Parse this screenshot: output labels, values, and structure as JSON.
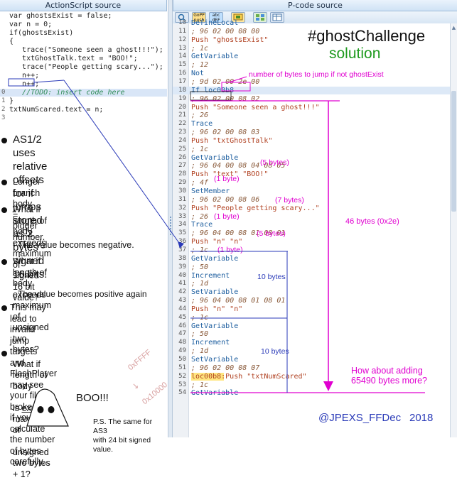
{
  "headers": {
    "left": "ActionScript source",
    "right": "P-code source"
  },
  "toolbar": {
    "buttons": [
      {
        "label": "",
        "icon": "search-icon"
      },
      {
        "label": "GoPP push"
      },
      {
        "label": "abc dEF"
      },
      {
        "label": "",
        "icon": "deobfuscate-icon"
      },
      {
        "label": "",
        "icon": "grid-icon"
      },
      {
        "label": "",
        "icon": "table-icon"
      }
    ]
  },
  "as_lines": [
    {
      "n": "",
      "t": "var ghostsExist = false;"
    },
    {
      "n": "",
      "t": "var n = 0;"
    },
    {
      "n": "",
      "t": "if(ghostsExist)"
    },
    {
      "n": "",
      "t": "{"
    },
    {
      "n": "",
      "t": "   trace(\"Someone seen a ghost!!!\");"
    },
    {
      "n": "",
      "t": "   txtGhostTalk.text = \"BOO!\";"
    },
    {
      "n": "",
      "t": "   trace(\"People getting scary...\");"
    },
    {
      "n": "",
      "t": "   n++;"
    },
    {
      "n": "",
      "t": "   n++;"
    },
    {
      "n": "0",
      "t": "   //TODO: insert code here"
    },
    {
      "n": "1",
      "t": "}"
    },
    {
      "n": "2",
      "t": "txtNumScared.text = n;"
    },
    {
      "n": "3",
      "t": ""
    }
  ],
  "info": {
    "b1": "AS1/2 uses relative offsets\nfor if jumps stored as 2\nbytes - signed 16 bits.",
    "b2": "Longer branch body\n= bigger number.",
    "b3": "What if length of body\nexceeds maximum of\nsigned 16 bit value?",
    "b3sub": "- The value becomes negative.",
    "b4": "What if length of body\nexceeds maximum of\nunsigned two bytes?",
    "b4sub": "- The value becomes positive again",
    "b5": "This may lead to invalid jump targets\nand FlashPlayer may see\nyour file broken, but if you calculate\nthe number of bytes carefully...",
    "b6a": "What if length of body",
    "b6b": "is ",
    "b6c": "exactly",
    "b6d": " maximum of",
    "b6e": "unsigned two bytes + 1?",
    "hex1": "0xFFFF",
    "hex2": "0x10000",
    "boo": "BOO!!!",
    "ps": "P.S. The same for AS3\nwith 24 bit signed value."
  },
  "pcode_lines": [
    {
      "n": "10",
      "t": "DefineLocal",
      "k": "i"
    },
    {
      "n": "11",
      "t": "; 96 02 00 08 00",
      "k": "c"
    },
    {
      "n": "12",
      "t": "Push \"ghostsExist\"",
      "k": "p"
    },
    {
      "n": "13",
      "t": "; 1c",
      "k": "c"
    },
    {
      "n": "14",
      "t": "GetVariable",
      "k": "i"
    },
    {
      "n": "15",
      "t": "; 12",
      "k": "c"
    },
    {
      "n": "16",
      "t": "Not",
      "k": "i"
    },
    {
      "n": "17",
      "t": "; 9d 02 00 2e 00",
      "k": "c"
    },
    {
      "n": "18",
      "t": "If loc00b8",
      "k": "if"
    },
    {
      "n": "19",
      "t": "; 96 02 00 08 02",
      "k": "c"
    },
    {
      "n": "20",
      "t": "Push \"Someone seen a ghost!!!\"",
      "k": "p"
    },
    {
      "n": "21",
      "t": "; 26",
      "k": "c"
    },
    {
      "n": "22",
      "t": "Trace",
      "k": "i"
    },
    {
      "n": "23",
      "t": "; 96 02 00 08 03",
      "k": "c"
    },
    {
      "n": "24",
      "t": "Push \"txtGhostTalk\"",
      "k": "p"
    },
    {
      "n": "25",
      "t": "; 1c",
      "k": "c"
    },
    {
      "n": "26",
      "t": "GetVariable",
      "k": "i"
    },
    {
      "n": "27",
      "t": "; 96 04 00 08 04 08 05",
      "k": "c"
    },
    {
      "n": "28",
      "t": "Push \"text\" \"BOO!\"",
      "k": "p"
    },
    {
      "n": "29",
      "t": "; 4f",
      "k": "c"
    },
    {
      "n": "30",
      "t": "SetMember",
      "k": "i"
    },
    {
      "n": "31",
      "t": "; 96 02 00 08 06",
      "k": "c"
    },
    {
      "n": "32",
      "t": "Push \"People getting scary...\"",
      "k": "p"
    },
    {
      "n": "33",
      "t": "; 26",
      "k": "c"
    },
    {
      "n": "34",
      "t": "Trace",
      "k": "i"
    },
    {
      "n": "35",
      "t": "; 96 04 00 08 01 08 01",
      "k": "c"
    },
    {
      "n": "36",
      "t": "Push \"n\" \"n\"",
      "k": "p"
    },
    {
      "n": "37",
      "t": "; 1c",
      "k": "c"
    },
    {
      "n": "38",
      "t": "GetVariable",
      "k": "i"
    },
    {
      "n": "39",
      "t": "; 50",
      "k": "c"
    },
    {
      "n": "40",
      "t": "Increment",
      "k": "i"
    },
    {
      "n": "41",
      "t": "; 1d",
      "k": "c"
    },
    {
      "n": "42",
      "t": "SetVariable",
      "k": "i"
    },
    {
      "n": "43",
      "t": "; 96 04 00 08 01 08 01",
      "k": "c"
    },
    {
      "n": "44",
      "t": "Push \"n\" \"n\"",
      "k": "p"
    },
    {
      "n": "45",
      "t": "; 1c",
      "k": "c"
    },
    {
      "n": "46",
      "t": "GetVariable",
      "k": "i"
    },
    {
      "n": "47",
      "t": "; 50",
      "k": "c"
    },
    {
      "n": "48",
      "t": "Increment",
      "k": "i"
    },
    {
      "n": "49",
      "t": "; 1d",
      "k": "c"
    },
    {
      "n": "50",
      "t": "SetVariable",
      "k": "i"
    },
    {
      "n": "51",
      "t": "; 96 02 00 08 07",
      "k": "c"
    },
    {
      "n": "52",
      "t": "loc00b8:Push \"txtNumScared\"",
      "k": "lbl"
    },
    {
      "n": "53",
      "t": "; 1c",
      "k": "c"
    },
    {
      "n": "54",
      "t": "GetVariable",
      "k": "i"
    }
  ],
  "overlay": {
    "title": "#ghostChallenge",
    "solution": "solution",
    "jump_note": "number of bytes to jump if not ghostExist",
    "b5bytes_a": "(5 bytes)",
    "b1byte_a": "(1 byte)",
    "b7bytes": "(7 bytes)",
    "b1byte_b": "(1 byte)",
    "b5bytes_b": "(5 bytes)",
    "b1byte_c": "(1 byte)",
    "b46": "46 bytes (0x2e)",
    "b10a": "10 bytes",
    "b10b": "10 bytes",
    "adding": "How about adding\n65490 bytes more?",
    "credit": "@JPEXS_FFDec",
    "year": "2018"
  },
  "colors": {
    "magenta": "#e000d0",
    "green": "#1e9a1e",
    "blue": "#2a3ab8"
  }
}
